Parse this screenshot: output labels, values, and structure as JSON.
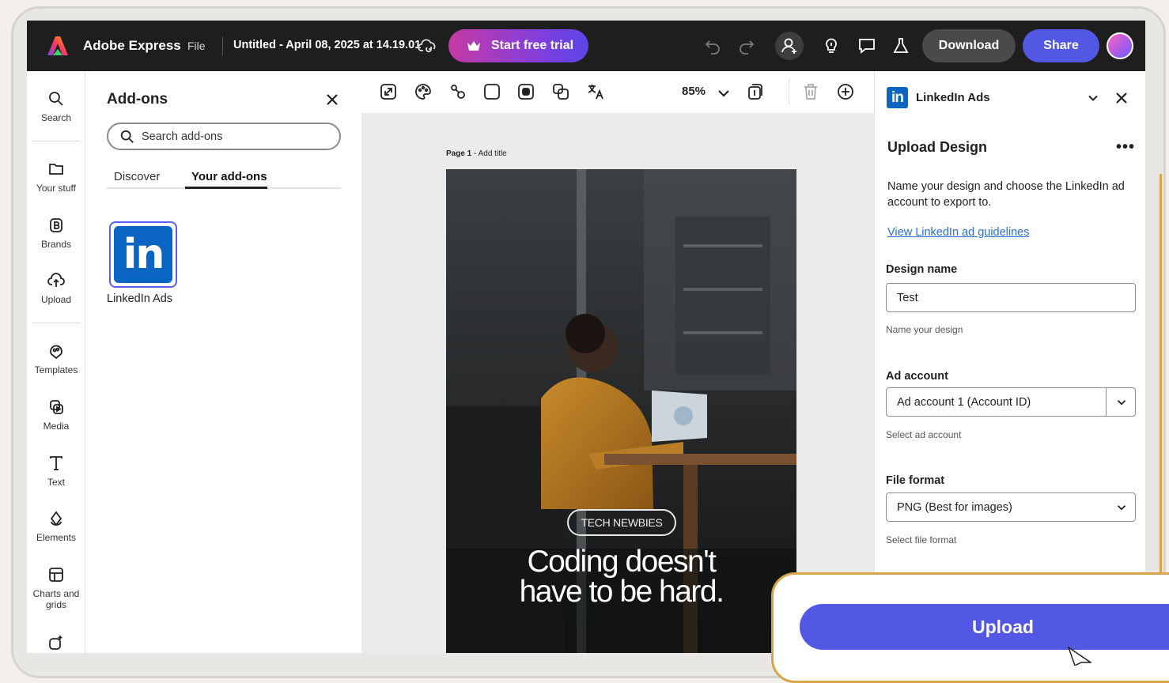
{
  "topbar": {
    "brand": "Adobe Express",
    "file_menu": "File",
    "doc_title": "Untitled - April 08, 2025 at 14.19.01",
    "trial_label": "Start free trial",
    "download_label": "Download",
    "share_label": "Share"
  },
  "rail": {
    "items": [
      {
        "label": "Search",
        "icon": "search-icon"
      },
      {
        "label": "Your stuff",
        "icon": "folder-icon"
      },
      {
        "label": "Brands",
        "icon": "brand-icon"
      },
      {
        "label": "Upload",
        "icon": "upload-icon"
      },
      {
        "label": "Templates",
        "icon": "templates-icon"
      },
      {
        "label": "Media",
        "icon": "media-icon"
      },
      {
        "label": "Text",
        "icon": "text-icon"
      },
      {
        "label": "Elements",
        "icon": "elements-icon"
      },
      {
        "label": "Charts and grids",
        "icon": "charts-icon"
      }
    ]
  },
  "addons": {
    "title": "Add-ons",
    "search_placeholder": "Search add-ons",
    "tabs": [
      "Discover",
      "Your add-ons"
    ],
    "active_tab": "Your add-ons",
    "tile_mark": "in",
    "tile_label": "LinkedIn Ads"
  },
  "canvas": {
    "zoom": "85%",
    "page_label": "Page 1",
    "page_add_title": "- Add title",
    "poster_pill": "TECH NEWBIES",
    "poster_line1": "Coding doesn't",
    "poster_line2": "have to be hard."
  },
  "panel": {
    "logo_mark": "in",
    "addon_name": "LinkedIn Ads",
    "heading": "Upload Design",
    "more": "•••",
    "description": "Name your design and choose the LinkedIn ad account to export to.",
    "guidelines_link": "View LinkedIn ad guidelines",
    "design_name_label": "Design name",
    "design_name_value": "Test",
    "design_name_help": "Name your design",
    "ad_account_label": "Ad account",
    "ad_account_value": "Ad account 1 (Account ID)",
    "ad_account_help": "Select ad account",
    "file_format_label": "File format",
    "file_format_value": "PNG (Best for images)",
    "file_format_help": "Select file format",
    "upload_label": "Upload"
  },
  "colors": {
    "accent": "#5258e4",
    "linkedin": "#0a66c2",
    "callout_border": "#d9a449",
    "topbar": "#1e1e1e"
  }
}
